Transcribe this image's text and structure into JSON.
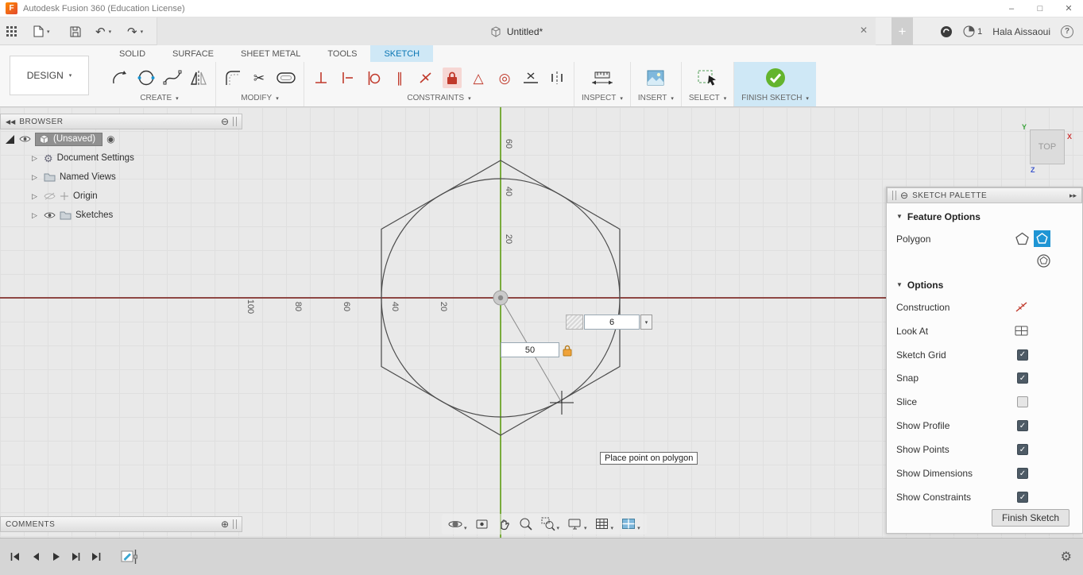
{
  "title_bar": {
    "app_title": "Autodesk Fusion 360 (Education License)"
  },
  "quickbar": {
    "doc_tab": "Untitled*",
    "user_name": "Hala Aissaoui",
    "notification_count": "1"
  },
  "ribbon": {
    "design_label": "DESIGN",
    "tabs": [
      {
        "label": "SOLID"
      },
      {
        "label": "SURFACE"
      },
      {
        "label": "SHEET METAL"
      },
      {
        "label": "TOOLS"
      },
      {
        "label": "SKETCH"
      }
    ],
    "groups": {
      "create": "CREATE",
      "modify": "MODIFY",
      "constraints": "CONSTRAINTS",
      "inspect": "INSPECT",
      "insert": "INSERT",
      "select": "SELECT",
      "finish": "FINISH SKETCH"
    }
  },
  "browser": {
    "title": "BROWSER",
    "root_label": "(Unsaved)",
    "items": [
      {
        "label": "Document Settings"
      },
      {
        "label": "Named Views"
      },
      {
        "label": "Origin"
      },
      {
        "label": "Sketches"
      }
    ]
  },
  "comments": {
    "title": "COMMENTS"
  },
  "canvas": {
    "viewcube_label": "TOP",
    "axis_y_letter": "Y",
    "axis_x_letter": "X",
    "axis_z_letter": "Z",
    "v_axis_labels": [
      "60",
      "40",
      "20"
    ],
    "h_axis_labels": [
      "100",
      "80",
      "60",
      "40",
      "20"
    ],
    "sides_value": "6",
    "radius_value": "50",
    "tooltip": "Place point on polygon"
  },
  "palette": {
    "title": "SKETCH PALETTE",
    "feature_section": "Feature Options",
    "feature_rows": [
      {
        "label": "Polygon"
      }
    ],
    "options_section": "Options",
    "options_rows": [
      {
        "label": "Construction"
      },
      {
        "label": "Look At"
      },
      {
        "label": "Sketch Grid",
        "mark": "✓"
      },
      {
        "label": "Snap",
        "mark": "✓"
      },
      {
        "label": "Slice",
        "mark": ""
      },
      {
        "label": "Show Profile",
        "mark": "✓"
      },
      {
        "label": "Show Points",
        "mark": "✓"
      },
      {
        "label": "Show Dimensions",
        "mark": "✓"
      },
      {
        "label": "Show Constraints",
        "mark": "✓"
      }
    ],
    "finish_button": "Finish Sketch"
  },
  "glyphs": {
    "dropdown": "▾",
    "collapse_left": "◀◀",
    "expand_right": "▸▸",
    "minus": "⊖",
    "plus": "⊕",
    "undo": "↶",
    "redo": "↷",
    "gear": "⚙",
    "scissors": "✂",
    "close": "✕",
    "window_min": "–",
    "window_max": "□",
    "help": "?",
    "record": "◉",
    "expander": "▷",
    "section_arrow": "▼",
    "tab_plus": "+",
    "triangle": "△",
    "concentric": "◎",
    "parallel": "∥"
  }
}
